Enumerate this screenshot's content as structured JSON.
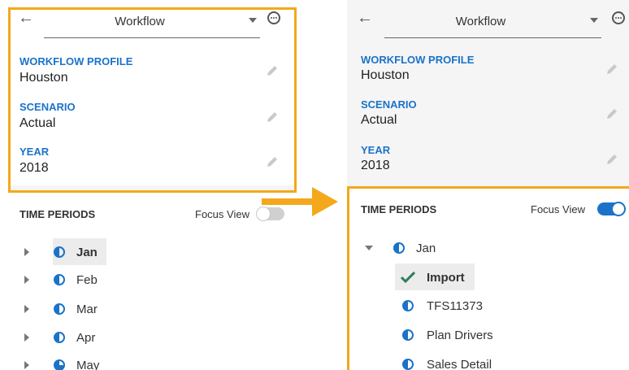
{
  "colors": {
    "accent": "#1a73c9",
    "highlight": "#f4a81c",
    "check": "#2e7d5b"
  },
  "left": {
    "header": {
      "back_icon": "arrow-left-icon",
      "workflow_label": "Workflow",
      "more_icon": "more-horizontal-icon"
    },
    "fields": [
      {
        "label": "WORKFLOW PROFILE",
        "value": "Houston"
      },
      {
        "label": "SCENARIO",
        "value": "Actual"
      },
      {
        "label": "YEAR",
        "value": "2018"
      }
    ],
    "time_periods": {
      "title": "TIME PERIODS",
      "focus_view_label": "Focus View",
      "focus_view_on": false,
      "items": [
        {
          "label": "Jan",
          "selected": true
        },
        {
          "label": "Feb"
        },
        {
          "label": "Mar"
        },
        {
          "label": "Apr"
        },
        {
          "label": "May"
        }
      ]
    }
  },
  "right": {
    "header": {
      "back_icon": "arrow-left-icon",
      "workflow_label": "Workflow",
      "more_icon": "more-horizontal-icon"
    },
    "fields": [
      {
        "label": "WORKFLOW PROFILE",
        "value": "Houston"
      },
      {
        "label": "SCENARIO",
        "value": "Actual"
      },
      {
        "label": "YEAR",
        "value": "2018"
      }
    ],
    "time_periods": {
      "title": "TIME PERIODS",
      "focus_view_label": "Focus View",
      "focus_view_on": true,
      "parent": "Jan",
      "children": [
        {
          "label": "Import",
          "selected": true,
          "icon": "check-icon"
        },
        {
          "label": "TFS11373",
          "icon": "half-circle-icon"
        },
        {
          "label": "Plan Drivers",
          "icon": "half-circle-icon"
        },
        {
          "label": "Sales Detail",
          "icon": "half-circle-icon"
        }
      ]
    }
  }
}
